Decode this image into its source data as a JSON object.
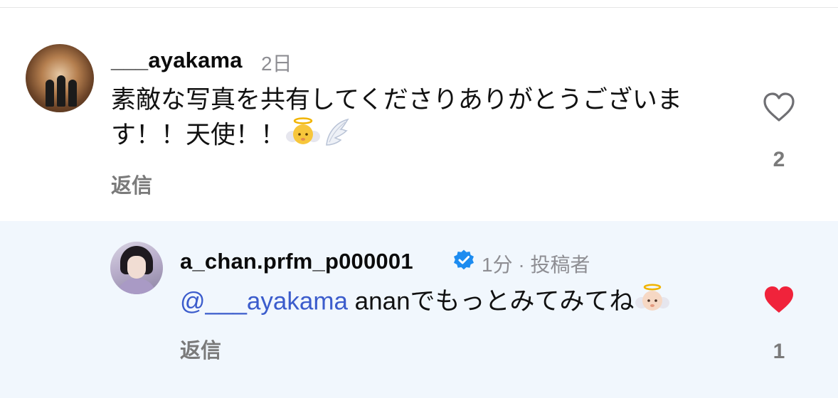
{
  "comments": [
    {
      "username": "___ayakama",
      "meta": "2日",
      "text": "素敵な写真を共有してくださりありがとうございます！！天使！！",
      "emojis": [
        "angel-baby-emoji",
        "wing-emoji"
      ],
      "reply_label": "返信",
      "like_count": "2",
      "liked": false
    },
    {
      "username": "a_chan.prfm_p000001",
      "verified": true,
      "meta": "1分 · 投稿者",
      "mention": "@___ayakama",
      "text": " ananでもっとみてみてね",
      "emojis": [
        "angel-baby-emoji"
      ],
      "reply_label": "返信",
      "like_count": "1",
      "liked": true
    }
  ],
  "colors": {
    "heart_liked": "#f0233b",
    "heart_outline": "#6f6f73",
    "mention": "#3b5ccc",
    "reply_highlight_bg": "#f1f7fd",
    "verified_badge": "#1d8cf0"
  }
}
